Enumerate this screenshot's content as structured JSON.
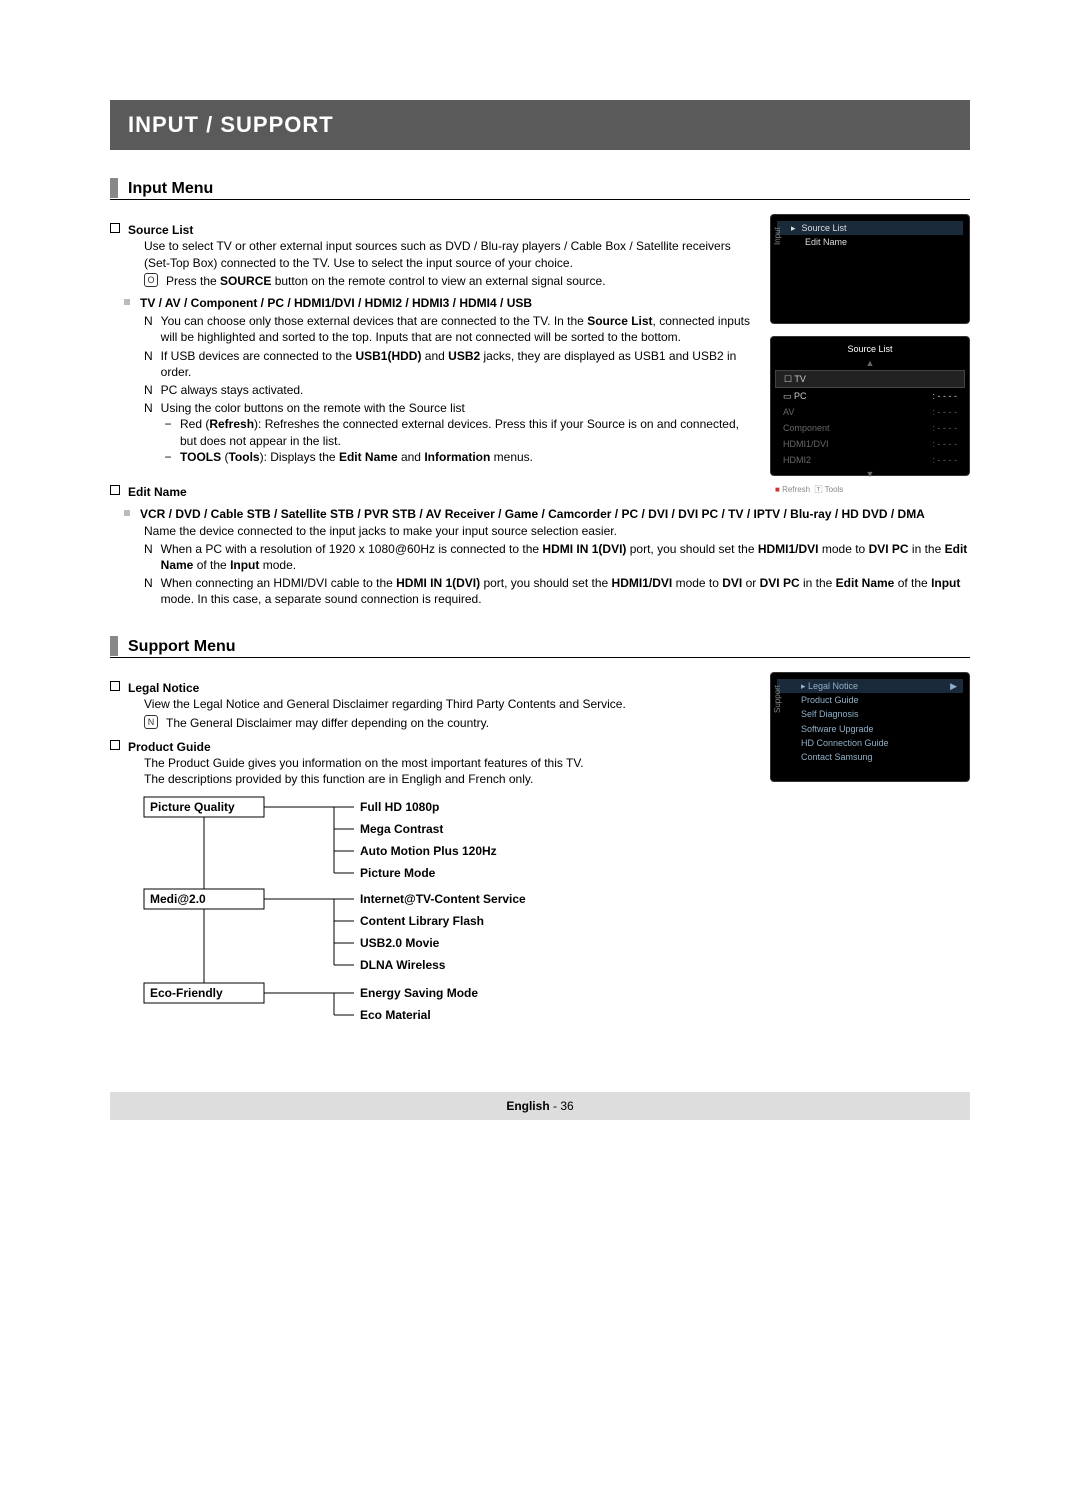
{
  "banner": "INPUT / SUPPORT",
  "section1": "Input Menu",
  "sourceList": {
    "title": "Source List",
    "desc": "Use to select TV or other external input sources such as DVD / Blu-ray players / Cable Box / Satellite receivers (Set-Top Box) connected to the TV. Use to select the input source of your choice.",
    "press_prefix": "Press the ",
    "press_bold": "SOURCE",
    "press_suffix": " button on the remote control to view an external signal source."
  },
  "tvav": {
    "title": "TV / AV / Component / PC / HDMI1/DVI / HDMI2 / HDMI3 / HDMI4 / USB",
    "n1a": "You can choose only those external devices that are connected to the TV. In the ",
    "n1b": "Source List",
    "n1c": ", connected inputs will be highlighted and sorted to the top. Inputs that are not connected will be sorted to the bottom.",
    "n2a": "If USB devices are connected to the ",
    "n2b": "USB1(HDD)",
    "n2c": " and ",
    "n2d": "USB2",
    "n2e": " jacks, they are displayed as USB1 and USB2 in order.",
    "n3": "PC always stays activated.",
    "n4": "Using the color buttons on the remote with the Source list",
    "d1a": "Red (",
    "d1b": "Refresh",
    "d1c": "): Refreshes the connected external devices. Press this if your Source is on and connected, but does not appear in the list.",
    "d2a": "TOOLS",
    "d2b": " (",
    "d2c": "Tools",
    "d2d": "): Displays the ",
    "d2e": "Edit Name",
    "d2f": " and ",
    "d2g": "Information",
    "d2h": " menus."
  },
  "editName": {
    "title": "Edit Name",
    "devices": "VCR / DVD / Cable STB / Satellite STB / PVR STB / AV Receiver / Game / Camcorder / PC / DVI / DVI PC / TV / IPTV / Blu-ray / HD DVD / DMA",
    "desc": "Name the device connected to the input jacks to make your input source selection easier.",
    "n1": "When a PC with a resolution of 1920 x 1080@60Hz is connected to the HDMI IN 1(DVI) port, you should set the HDMI1/DVI mode to DVI PC in the Edit Name of the Input mode.",
    "n2": "When connecting an HDMI/DVI cable to the HDMI IN 1(DVI) port, you should set the HDMI1/DVI mode to DVI or DVI PC in the Edit Name of the Input mode. In this case, a separate sound connection is required."
  },
  "section2": "Support Menu",
  "legal": {
    "title": "Legal Notice",
    "desc": "View the Legal Notice and General Disclaimer regarding Third Party Contents and Service.",
    "note": "The General Disclaimer may differ depending on the country."
  },
  "guide": {
    "title": "Product Guide",
    "desc1": "The Product Guide gives you information on the most important features of this TV.",
    "desc2": "The descriptions provided by this function are in Engligh and French only."
  },
  "tree": {
    "c1": "Picture Quality",
    "c1_items": [
      "Full HD 1080p",
      "Mega Contrast",
      "Auto Motion Plus 120Hz",
      "Picture Mode"
    ],
    "c2": "Medi@2.0",
    "c2_items": [
      "Internet@TV-Content Service",
      "Content Library Flash",
      "USB2.0 Movie",
      "DLNA Wireless"
    ],
    "c3": "Eco-Friendly",
    "c3_items": [
      "Energy Saving Mode",
      "Eco Material"
    ]
  },
  "osd1": {
    "tab": "Input",
    "items": [
      "Source List",
      "Edit Name"
    ]
  },
  "osd2": {
    "title": "Source List",
    "rows": [
      {
        "label": "TV",
        "val": ""
      },
      {
        "label": "PC",
        "val": ": - - - -"
      },
      {
        "label": "AV",
        "val": ": - - - -"
      },
      {
        "label": "Component",
        "val": ": - - - -"
      },
      {
        "label": "HDMI1/DVI",
        "val": ": - - - -"
      },
      {
        "label": "HDMI2",
        "val": ": - - - -"
      }
    ],
    "refresh": "Refresh",
    "tools": "Tools"
  },
  "osd3": {
    "tab": "Support",
    "items": [
      "Legal Notice",
      "Product Guide",
      "Self Diagnosis",
      "Software Upgrade",
      "HD Connection Guide",
      "Contact Samsung"
    ]
  },
  "footer": {
    "lang": "English",
    "page": "36"
  }
}
